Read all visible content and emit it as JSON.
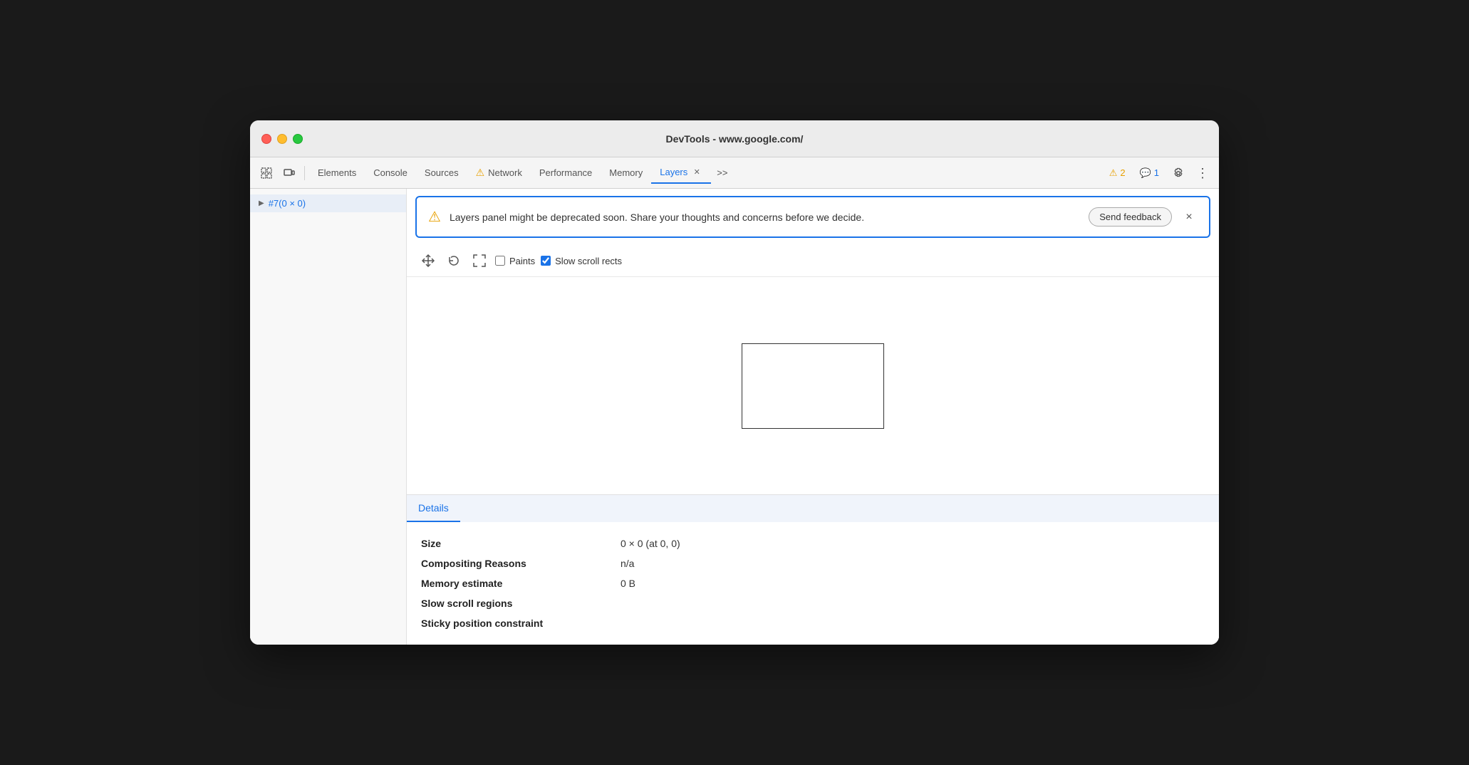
{
  "window": {
    "title": "DevTools - www.google.com/"
  },
  "toolbar": {
    "icons": {
      "inspector": "⠿",
      "device": "▭"
    },
    "tabs": [
      {
        "id": "elements",
        "label": "Elements",
        "active": false,
        "warning": false
      },
      {
        "id": "console",
        "label": "Console",
        "active": false,
        "warning": false
      },
      {
        "id": "sources",
        "label": "Sources",
        "active": false,
        "warning": false
      },
      {
        "id": "network",
        "label": "Network",
        "active": false,
        "warning": true
      },
      {
        "id": "performance",
        "label": "Performance",
        "active": false,
        "warning": false
      },
      {
        "id": "memory",
        "label": "Memory",
        "active": false,
        "warning": false
      },
      {
        "id": "layers",
        "label": "Layers",
        "active": true,
        "warning": false
      }
    ],
    "more_tabs": ">>",
    "warning_count": "2",
    "info_count": "1"
  },
  "sidebar": {
    "items": [
      {
        "id": "layer1",
        "label": "#7(0 × 0)",
        "selected": true,
        "has_arrow": true
      }
    ]
  },
  "warning_banner": {
    "message": "Layers panel might be deprecated soon. Share your thoughts and concerns before we decide.",
    "send_feedback_label": "Send feedback",
    "close_label": "×"
  },
  "canvas_toolbar": {
    "tools": [
      {
        "id": "pan",
        "icon": "✛"
      },
      {
        "id": "rotate",
        "icon": "↻"
      },
      {
        "id": "fit",
        "icon": "⤢"
      }
    ],
    "paints_label": "Paints",
    "slow_scroll_label": "Slow scroll rects",
    "paints_checked": false,
    "slow_scroll_checked": true
  },
  "details": {
    "tab_label": "Details",
    "rows": [
      {
        "label": "Size",
        "value": "0 × 0 (at 0, 0)"
      },
      {
        "label": "Compositing Reasons",
        "value": "n/a"
      },
      {
        "label": "Memory estimate",
        "value": "0 B"
      },
      {
        "label": "Slow scroll regions",
        "value": ""
      },
      {
        "label": "Sticky position constraint",
        "value": ""
      }
    ]
  },
  "colors": {
    "accent_blue": "#1a73e8",
    "warning_yellow": "#e8a000",
    "active_tab": "#1a73e8"
  }
}
